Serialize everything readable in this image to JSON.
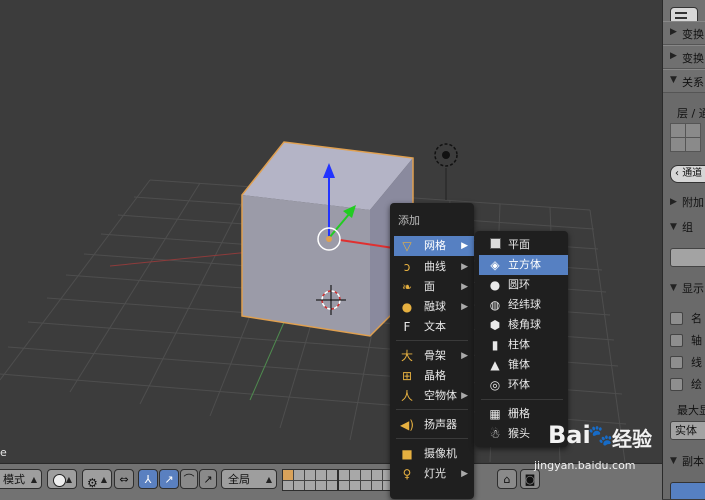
{
  "viewport": {
    "corner_text": "e"
  },
  "add_menu": {
    "title": "添加",
    "items": [
      {
        "label": "网格",
        "icon": "mesh-icon",
        "submenu": true
      },
      {
        "label": "曲线",
        "icon": "curve-icon",
        "submenu": true
      },
      {
        "label": "面",
        "icon": "surface-icon",
        "submenu": true
      },
      {
        "label": "融球",
        "icon": "metaball-icon",
        "submenu": true
      },
      {
        "label": "文本",
        "icon": "text-icon",
        "submenu": false
      },
      {
        "label": "骨架",
        "icon": "armature-icon",
        "submenu": true
      },
      {
        "label": "晶格",
        "icon": "lattice-icon",
        "submenu": false
      },
      {
        "label": "空物体",
        "icon": "empty-icon",
        "submenu": true
      },
      {
        "label": "扬声器",
        "icon": "speaker-icon",
        "submenu": false
      },
      {
        "label": "摄像机",
        "icon": "camera-icon",
        "submenu": false
      },
      {
        "label": "灯光",
        "icon": "lamp-icon",
        "submenu": true
      }
    ]
  },
  "mesh_menu": {
    "items": [
      {
        "label": "平面",
        "icon": "plane-icon"
      },
      {
        "label": "立方体",
        "icon": "cube-icon"
      },
      {
        "label": "圆环",
        "icon": "circle-icon"
      },
      {
        "label": "经纬球",
        "icon": "uv-sphere-icon"
      },
      {
        "label": "棱角球",
        "icon": "ico-sphere-icon"
      },
      {
        "label": "柱体",
        "icon": "cylinder-icon"
      },
      {
        "label": "锥体",
        "icon": "cone-icon"
      },
      {
        "label": "环体",
        "icon": "torus-icon"
      },
      {
        "label": "栅格",
        "icon": "grid-icon"
      },
      {
        "label": "猴头",
        "icon": "monkey-icon"
      }
    ],
    "highlighted": "立方体"
  },
  "properties": {
    "rows": [
      "变换",
      "变换",
      "关系"
    ],
    "layer_label": "层 / 通",
    "pill_label": "通道",
    "section_add": "附加",
    "section_group": "组",
    "section_display": "显示",
    "checks": [
      "名",
      "轴",
      "线",
      "绘"
    ],
    "max_label": "最大显",
    "solid_label": "实体",
    "copy_label": "副本"
  },
  "bottom_bar": {
    "mode_label": "模式",
    "global_label": "全局"
  },
  "watermark": {
    "brand": "Bai",
    "brand_cn": "经验",
    "url": "jingyan.baidu.com"
  },
  "colors": {
    "highlight": "#5680c2",
    "menu_bg": "#1f1f1f",
    "cube_face": "#9d9dab",
    "selection_outline": "#e0a050"
  }
}
